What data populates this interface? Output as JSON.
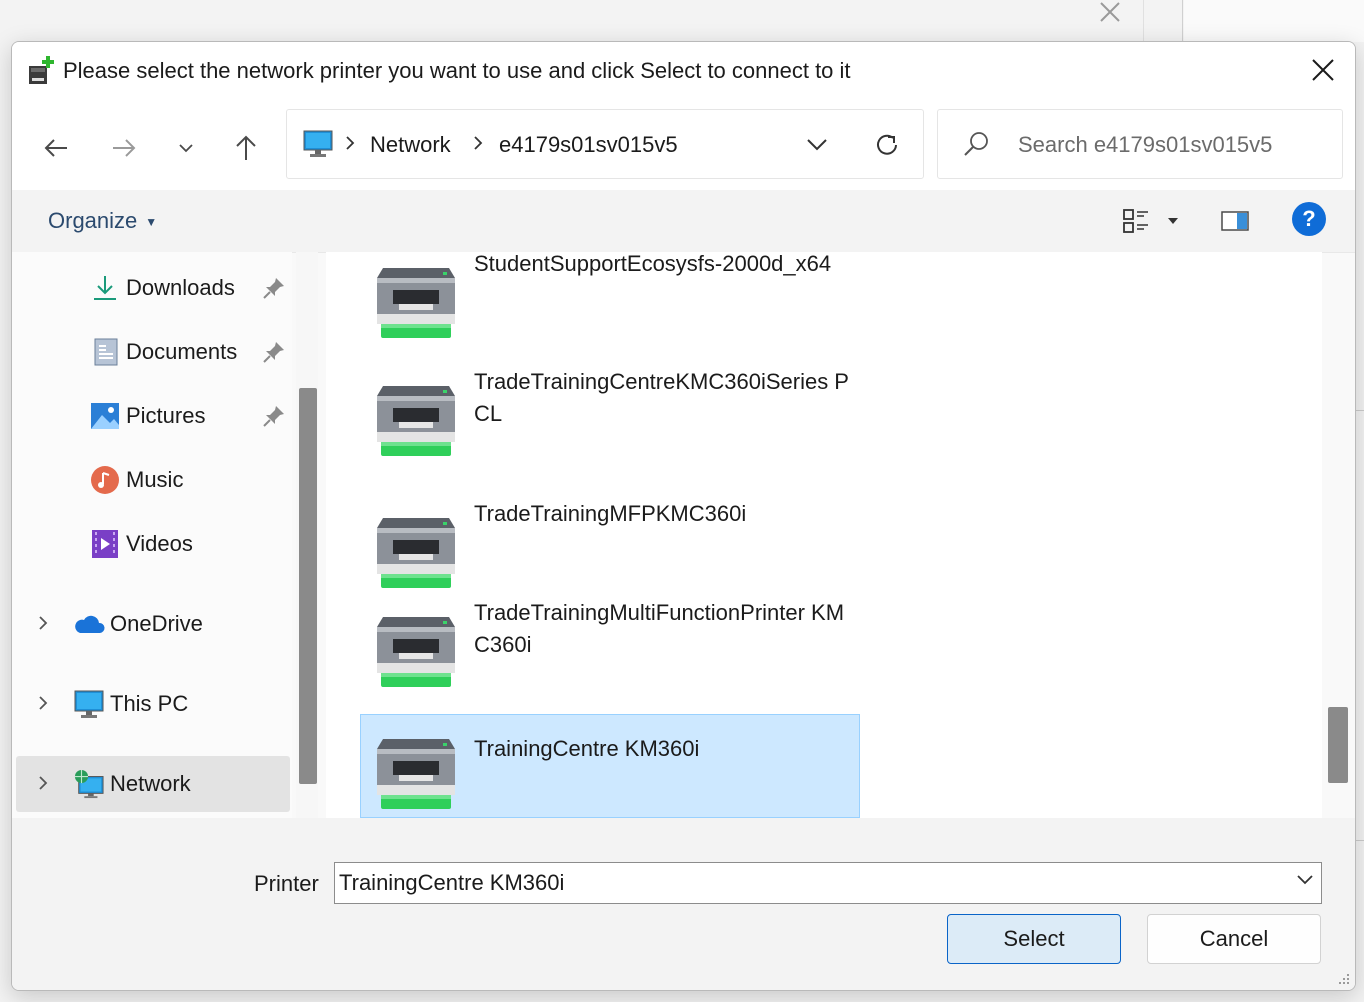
{
  "dialog": {
    "title": "Please select the network printer you want to use and click Select to connect to it"
  },
  "navigation": {
    "breadcrumbs": [
      "Network",
      "e4179s01sv015v5"
    ],
    "search_placeholder": "Search e4179s01sv015v5"
  },
  "toolbar": {
    "organize_label": "Organize"
  },
  "sidebar": {
    "items": [
      {
        "label": "Downloads",
        "icon": "download-icon",
        "pinned": true
      },
      {
        "label": "Documents",
        "icon": "document-icon",
        "pinned": true
      },
      {
        "label": "Pictures",
        "icon": "pictures-icon",
        "pinned": true
      },
      {
        "label": "Music",
        "icon": "music-icon",
        "pinned": false
      },
      {
        "label": "Videos",
        "icon": "videos-icon",
        "pinned": false
      },
      {
        "label": "OneDrive",
        "icon": "cloud-icon",
        "expandable": true
      },
      {
        "label": "This PC",
        "icon": "computer-icon",
        "expandable": true
      },
      {
        "label": "Network",
        "icon": "network-icon",
        "expandable": true,
        "selected": true
      }
    ]
  },
  "printers": [
    {
      "name": "StudentSupportEcosysfs-2000d_x64",
      "selected": false
    },
    {
      "name": "TradeTrainingCentreKMC360iSeries PCL",
      "selected": false
    },
    {
      "name": "TradeTrainingMFPKMC360i",
      "selected": false
    },
    {
      "name": "TradeTrainingMultiFunctionPrinter KMC360i",
      "selected": false
    },
    {
      "name": "TrainingCentre KM360i",
      "selected": true
    }
  ],
  "footer": {
    "printer_label": "Printer",
    "printer_value": "TrainingCentre KM360i",
    "select_label": "Select",
    "cancel_label": "Cancel"
  },
  "colors": {
    "accent": "#0f6cd7",
    "selection": "#cde8ff",
    "printer_tray": "#34c759"
  }
}
